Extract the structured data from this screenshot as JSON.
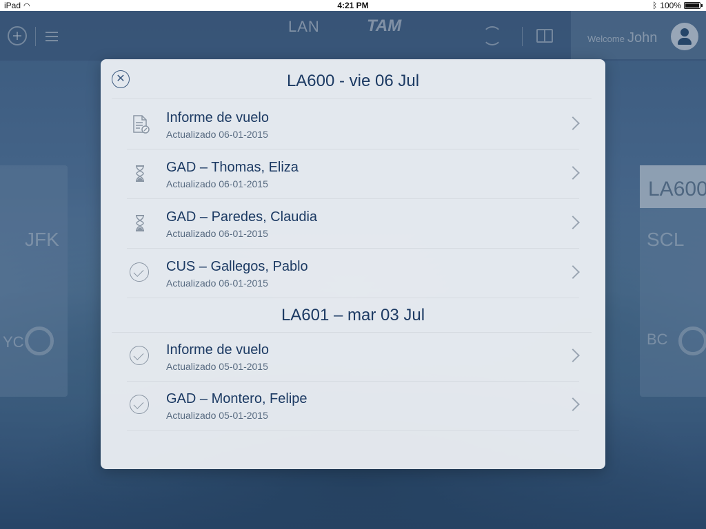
{
  "status_bar": {
    "device": "iPad",
    "time": "4:21 PM",
    "battery": "100%"
  },
  "header": {
    "logo_left": "LAN",
    "logo_right": "TAM",
    "welcome_label": "Welcome",
    "user_name": "John"
  },
  "background": {
    "left_card": {
      "city": "JFK",
      "cabin": "YC"
    },
    "right_card": {
      "flight": "LA600",
      "origin": "SCL",
      "cabin": "BC"
    }
  },
  "modal": {
    "sections": [
      {
        "header": "LA600  - vie 06 Jul",
        "rows": [
          {
            "title": "Informe de vuelo",
            "subtitle": "Actualizado 06-01-2015",
            "icon": "document-edit-icon"
          },
          {
            "title": "GAD – Thomas, Eliza",
            "subtitle": "Actualizado 06-01-2015",
            "icon": "hourglass-icon"
          },
          {
            "title": "GAD – Paredes, Claudia",
            "subtitle": "Actualizado 06-01-2015",
            "icon": "hourglass-icon"
          },
          {
            "title": "CUS – Gallegos, Pablo",
            "subtitle": "Actualizado 06-01-2015",
            "icon": "check-circle-icon"
          }
        ]
      },
      {
        "header": "LA601 – mar 03 Jul",
        "rows": [
          {
            "title": "Informe de vuelo",
            "subtitle": "Actualizado 05-01-2015",
            "icon": "check-circle-icon"
          },
          {
            "title": "GAD – Montero, Felipe",
            "subtitle": "Actualizado 05-01-2015",
            "icon": "check-circle-icon"
          }
        ]
      }
    ]
  },
  "colors": {
    "accent": "#1c3a63",
    "muted": "#576a80"
  }
}
